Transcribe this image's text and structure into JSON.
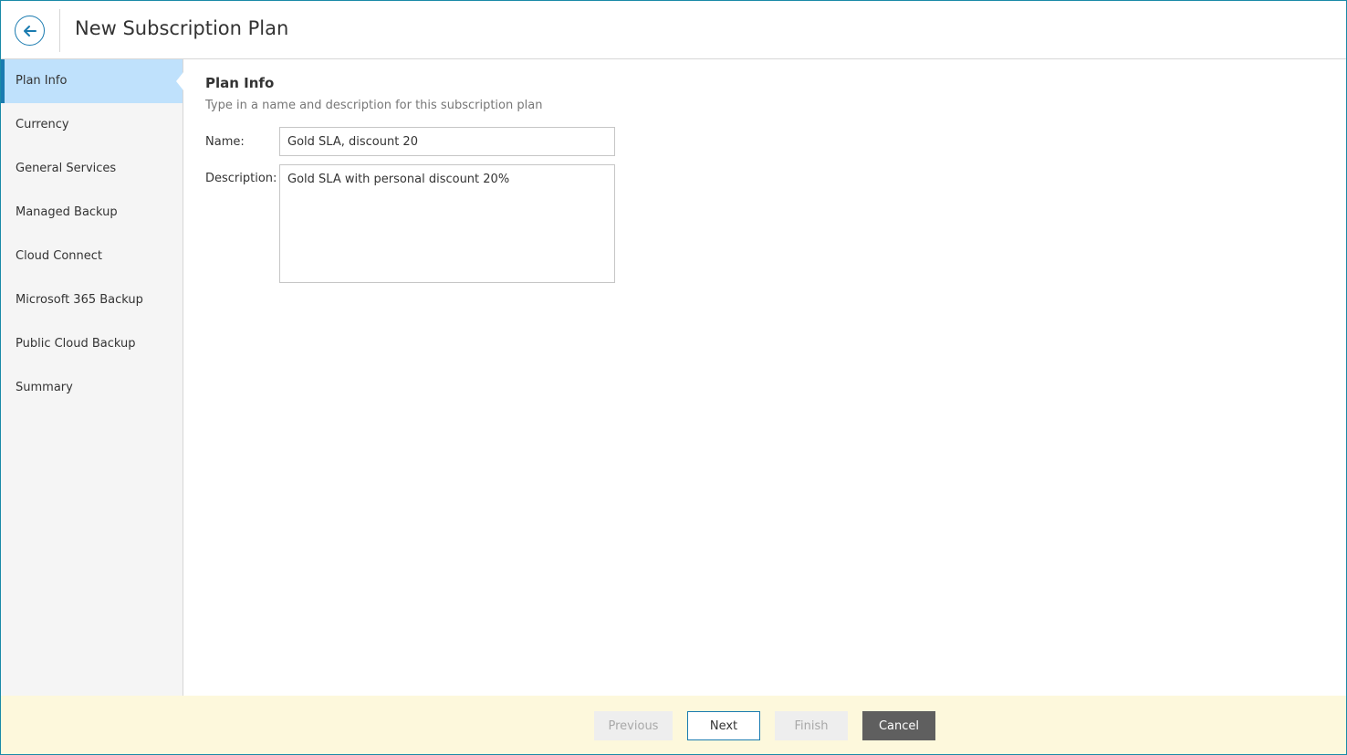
{
  "header": {
    "title": "New Subscription Plan",
    "back_icon": "arrow-left-circle-icon"
  },
  "sidebar": {
    "items": [
      {
        "label": "Plan Info",
        "active": true
      },
      {
        "label": "Currency",
        "active": false
      },
      {
        "label": "General Services",
        "active": false
      },
      {
        "label": "Managed Backup",
        "active": false
      },
      {
        "label": "Cloud Connect",
        "active": false
      },
      {
        "label": "Microsoft 365 Backup",
        "active": false
      },
      {
        "label": "Public Cloud Backup",
        "active": false
      },
      {
        "label": "Summary",
        "active": false
      }
    ]
  },
  "main": {
    "section_title": "Plan Info",
    "section_description": "Type in a name and description for this subscription plan",
    "name_label": "Name:",
    "name_value": "Gold SLA, discount 20",
    "description_label": "Description:",
    "description_value": "Gold SLA with personal discount 20%"
  },
  "footer": {
    "previous_label": "Previous",
    "next_label": "Next",
    "finish_label": "Finish",
    "cancel_label": "Cancel"
  },
  "colors": {
    "accent": "#1a7bb0",
    "active_nav_bg": "#bfe1fc",
    "sidebar_bg": "#f5f5f5",
    "footer_bg": "#fdf8dc",
    "cancel_bg": "#5f5f5f"
  }
}
